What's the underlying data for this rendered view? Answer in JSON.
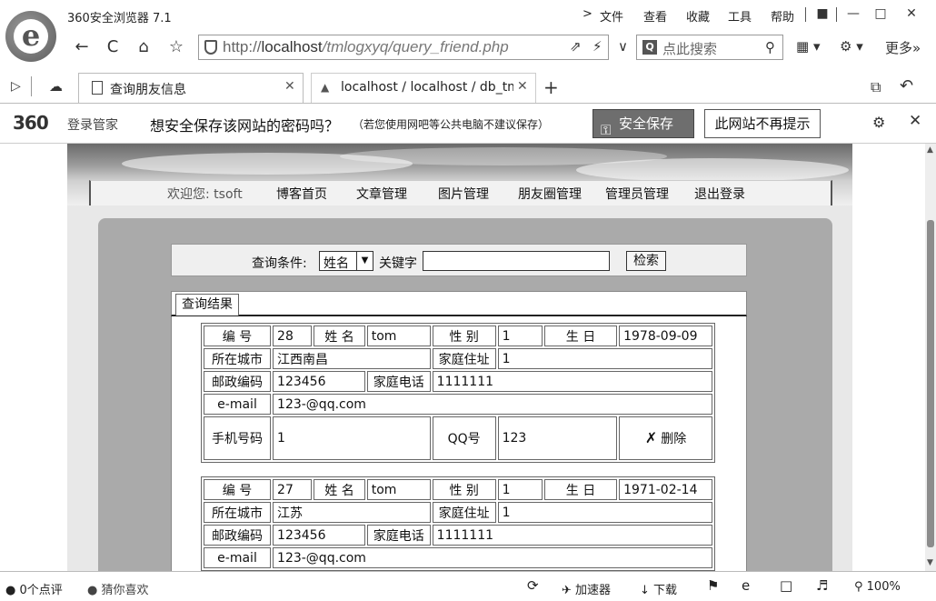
{
  "browser": {
    "app_title": "360安全浏览器 7.1",
    "menu": [
      "文件",
      "查看",
      "收藏",
      "工具",
      "帮助"
    ],
    "address": {
      "prefix": "http://",
      "host": "localhost",
      "path": "/tmlogxyq/query_friend.php"
    },
    "search_placeholder": "点此搜索",
    "more_label": "更多»",
    "tabs": [
      {
        "label": "查询朋友信息",
        "active": true
      },
      {
        "label": "localhost / localhost / db_tm",
        "active": false
      }
    ],
    "new_tab": "+",
    "zoom": "100%"
  },
  "password_bar": {
    "brand": "360",
    "brand_sub": "登录管家",
    "question": "想安全保存该网站的密码吗？",
    "note": "（若您使用网吧等公共电脑不建议保存）",
    "save_label": "安全保存",
    "no_prompt_label": "此网站不再提示"
  },
  "site_nav": {
    "welcome": "欢迎您: tsoft",
    "links": [
      "博客首页",
      "文章管理",
      "图片管理",
      "朋友圈管理",
      "管理员管理",
      "退出登录"
    ]
  },
  "query": {
    "label": "查询条件:",
    "select_value": "姓名",
    "keyword_label": "关键字",
    "keyword_value": "",
    "search_button": "检索"
  },
  "results": {
    "tab_label": "查询结果",
    "field_labels": {
      "id": "编 号",
      "name": "姓 名",
      "sex": "性 别",
      "birthday": "生 日",
      "city": "所在城市",
      "address": "家庭住址",
      "postcode": "邮政编码",
      "phone": "家庭电话",
      "email": "e-mail",
      "mobile": "手机号码",
      "qq": "QQ号",
      "delete": "删除"
    },
    "records": [
      {
        "id": "28",
        "name": "tom",
        "sex": "1",
        "birthday": "1978-09-09",
        "city": "江西南昌",
        "address": "1",
        "postcode": "123456",
        "phone": "1111111",
        "email": "123-@qq.com",
        "mobile": "1",
        "qq": "123"
      },
      {
        "id": "27",
        "name": "tom",
        "sex": "1",
        "birthday": "1971-02-14",
        "city": "江苏",
        "address": "1",
        "postcode": "123456",
        "phone": "1111111",
        "email": "123-@qq.com",
        "mobile": "",
        "qq": ""
      }
    ]
  },
  "statusbar": {
    "comments": "0个点评",
    "guess": "猜你喜欢",
    "accelerator": "加速器",
    "download": "下载",
    "zoom": "100%"
  }
}
